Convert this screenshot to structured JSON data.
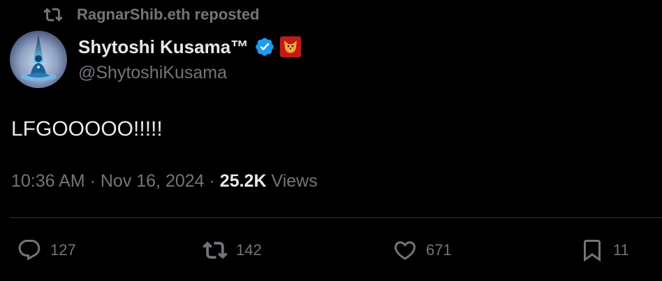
{
  "repost": {
    "icon": "repost-icon",
    "user": "RagnarShib.eth",
    "label": "reposted"
  },
  "author": {
    "avatar_icon": "meditating-figure-avatar",
    "name": "Shytoshi Kusama™",
    "verified_icon": "verified-badge-icon",
    "verified_color": "#1d9bf0",
    "affiliate_icon": "shiba-inu-badge-icon",
    "affiliate_color": "#c21a1a",
    "handle": "@ShytoshiKusama"
  },
  "tweet": {
    "text": "LFGOOOOO!!!!!"
  },
  "meta": {
    "time": "10:36 AM",
    "separator": " · ",
    "date": "Nov 16, 2024",
    "views_count": "25.2K",
    "views_label": "Views"
  },
  "actions": {
    "replies": {
      "icon": "reply-icon",
      "count": "127"
    },
    "reposts": {
      "icon": "repost-icon",
      "count": "142"
    },
    "likes": {
      "icon": "heart-icon",
      "count": "671"
    },
    "bookmarks": {
      "icon": "bookmark-icon",
      "count": "11"
    }
  },
  "colors": {
    "background": "#000000",
    "primary_text": "#e7e9ea",
    "secondary_text": "#71767b",
    "divider": "#2f3336"
  }
}
